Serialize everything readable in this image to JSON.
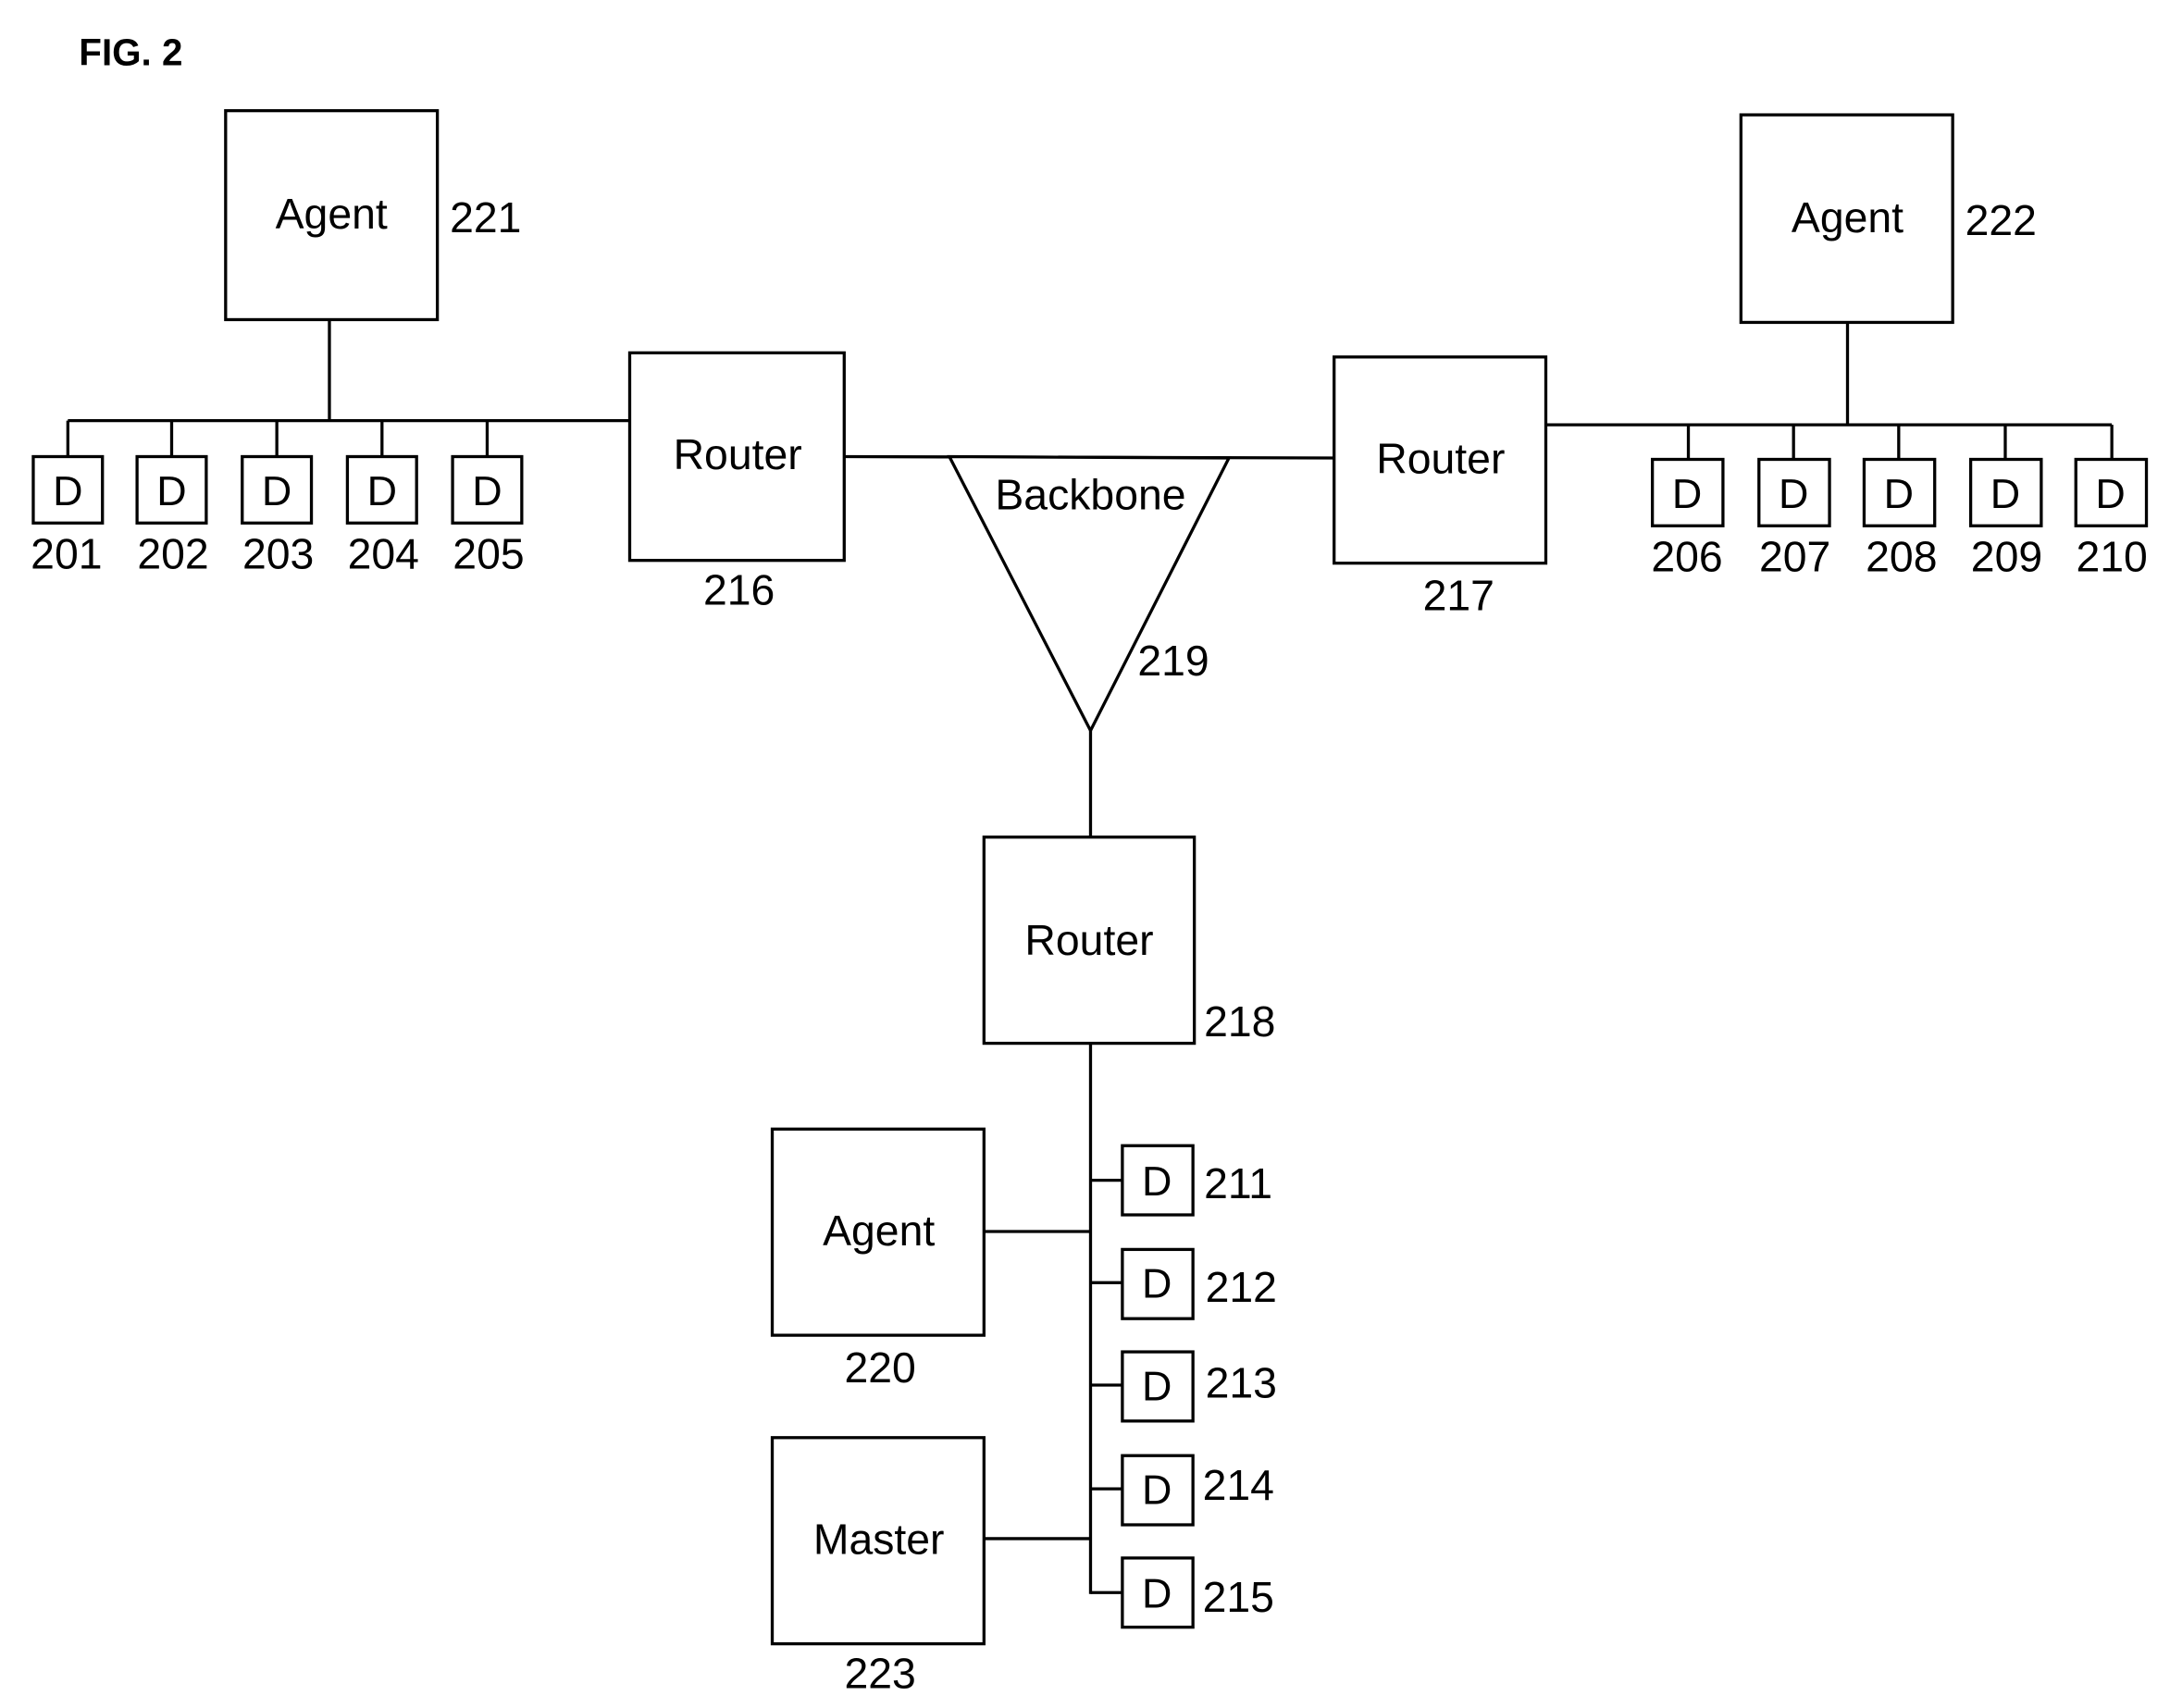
{
  "figure": {
    "title": "FIG. 2"
  },
  "nodes": {
    "agent221": {
      "label": "Agent",
      "ref": "221"
    },
    "agent222": {
      "label": "Agent",
      "ref": "222"
    },
    "agent220": {
      "label": "Agent",
      "ref": "220"
    },
    "master223": {
      "label": "Master",
      "ref": "223"
    },
    "router216": {
      "label": "Router",
      "ref": "216"
    },
    "router217": {
      "label": "Router",
      "ref": "217"
    },
    "router218": {
      "label": "Router",
      "ref": "218"
    },
    "backbone219": {
      "label": "Backbone",
      "ref": "219"
    }
  },
  "devices": {
    "left": [
      {
        "label": "D",
        "ref": "201"
      },
      {
        "label": "D",
        "ref": "202"
      },
      {
        "label": "D",
        "ref": "203"
      },
      {
        "label": "D",
        "ref": "204"
      },
      {
        "label": "D",
        "ref": "205"
      }
    ],
    "right": [
      {
        "label": "D",
        "ref": "206"
      },
      {
        "label": "D",
        "ref": "207"
      },
      {
        "label": "D",
        "ref": "208"
      },
      {
        "label": "D",
        "ref": "209"
      },
      {
        "label": "D",
        "ref": "210"
      }
    ],
    "bottom": [
      {
        "label": "D",
        "ref": "211"
      },
      {
        "label": "D",
        "ref": "212"
      },
      {
        "label": "D",
        "ref": "213"
      },
      {
        "label": "D",
        "ref": "214"
      },
      {
        "label": "D",
        "ref": "215"
      }
    ]
  }
}
